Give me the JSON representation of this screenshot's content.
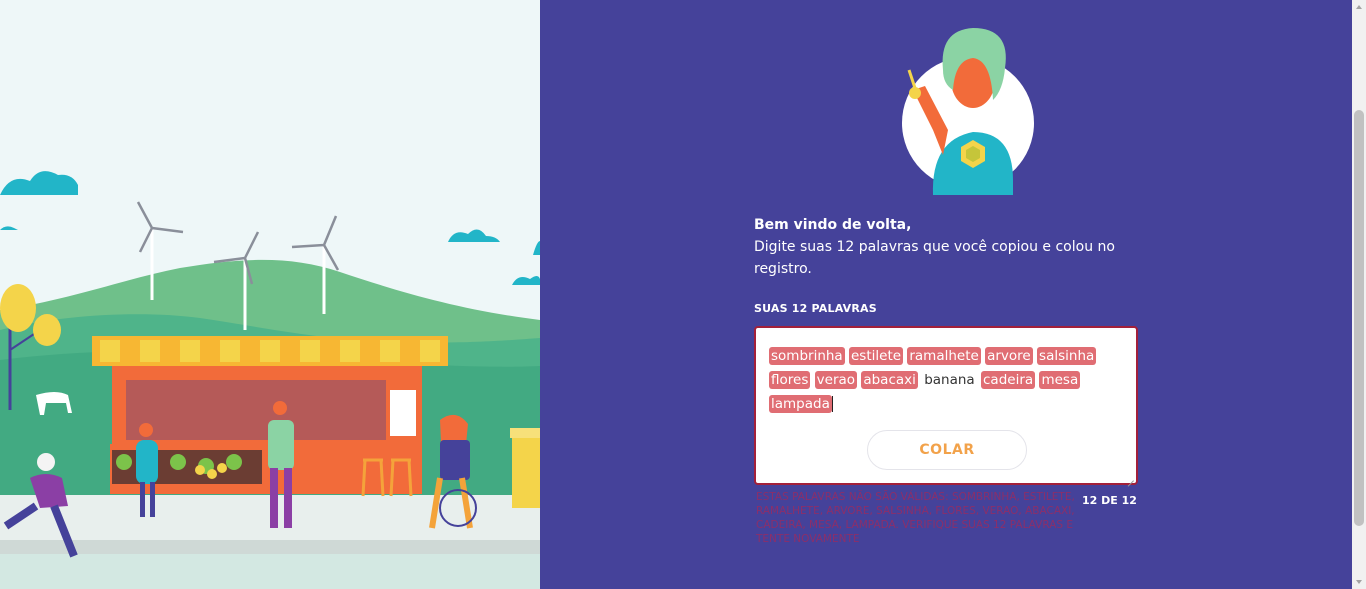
{
  "hero_illustration": "city market scene with wind turbines",
  "welcome": {
    "greeting": "Bem vindo de volta,",
    "instruction": "Digite suas 12 palavras que você copiou e colou no registro."
  },
  "seed_phrase": {
    "label": "SUAS 12 PALAVRAS",
    "words": [
      {
        "text": "sombrinha",
        "invalid": true
      },
      {
        "text": "estilete",
        "invalid": true
      },
      {
        "text": "ramalhete",
        "invalid": true
      },
      {
        "text": "arvore",
        "invalid": true
      },
      {
        "text": "salsinha",
        "invalid": true
      },
      {
        "text": "flores",
        "invalid": true
      },
      {
        "text": "verao",
        "invalid": true
      },
      {
        "text": "abacaxi",
        "invalid": true
      },
      {
        "text": "banana",
        "invalid": false
      },
      {
        "text": "cadeira",
        "invalid": true
      },
      {
        "text": "mesa",
        "invalid": true
      },
      {
        "text": "lampada",
        "invalid": true
      }
    ],
    "paste_label": "COLAR",
    "counter": "12 DE 12",
    "error": "ESTAS PALAVRAS NÃO SÃO VÁLIDAS: SOMBRINHA, ESTILETE, RAMALHETE, ARVORE, SALSINHA, FLORES, VERAO, ABACAXI, CADEIRA, MESA, LAMPADA. VERIFIQUE SUAS 12 PALAVRAS E TENTE NOVAMENTE"
  },
  "colors": {
    "panel": "#45429a",
    "chip": "#e06d73",
    "error_border": "#a3203a",
    "paste_text": "#f2a24a"
  }
}
